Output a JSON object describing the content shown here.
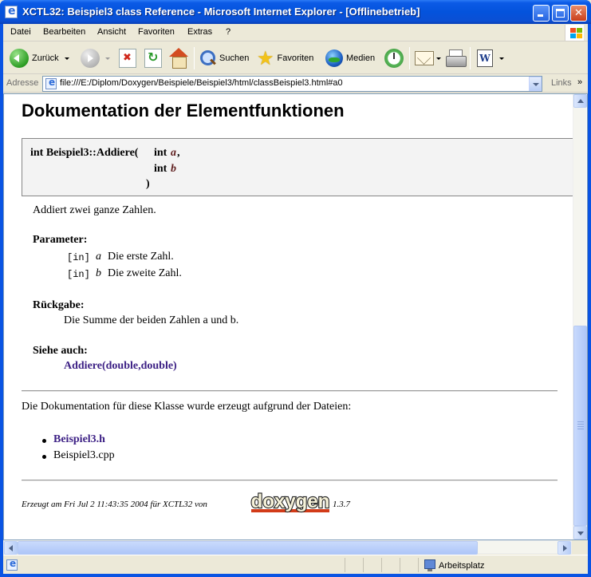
{
  "window": {
    "title": "XCTL32: Beispiel3 class Reference - Microsoft Internet Explorer - [Offlinebetrieb]"
  },
  "menu": [
    "Datei",
    "Bearbeiten",
    "Ansicht",
    "Favoriten",
    "Extras",
    "?"
  ],
  "toolbar": {
    "back_label": "Zurück",
    "search_label": "Suchen",
    "favorites_label": "Favoriten",
    "media_label": "Medien"
  },
  "address": {
    "label": "Adresse",
    "url": "file:///E:/Diplom/Doxygen/Beispiele/Beispiel3/html/classBeispiel3.html#a0",
    "links_label": "Links",
    "links_chevron": "»"
  },
  "doc": {
    "heading": "Dokumentation der Elementfunktionen",
    "proto": {
      "signature": "int Beispiel3::Addiere(",
      "param1_type": "int",
      "param1_name": "a",
      "param1_sep": ",",
      "param2_type": "int",
      "param2_name": "b",
      "close": ")"
    },
    "description": "Addiert zwei ganze Zahlen.",
    "params_heading": "Parameter:",
    "params": [
      {
        "dir": "[in]",
        "name": "a",
        "text": "Die erste Zahl."
      },
      {
        "dir": "[in]",
        "name": "b",
        "text": "Die zweite Zahl."
      }
    ],
    "return_heading": "Rückgabe:",
    "return_text": "Die Summe der beiden Zahlen a und b.",
    "see_heading": "Siehe auch:",
    "see_link": "Addiere(double,double)",
    "files_intro": "Die Dokumentation für diese Klasse wurde erzeugt aufgrund der Dateien:",
    "files": [
      {
        "name": "Beispiel3.h",
        "link": true
      },
      {
        "name": "Beispiel3.cpp",
        "link": false
      }
    ],
    "footer_prefix": "Erzeugt am Fri Jul 2 11:43:35 2004 für XCTL32 von",
    "footer_logo": "doxygen",
    "footer_version": "1.3.7"
  },
  "status": {
    "zone": "Arbeitsplatz"
  },
  "colors": {
    "titlebar": "#0453DC",
    "link": "#3D2185",
    "param_name": "#602020",
    "proto_bg": "#F3F3F3"
  }
}
